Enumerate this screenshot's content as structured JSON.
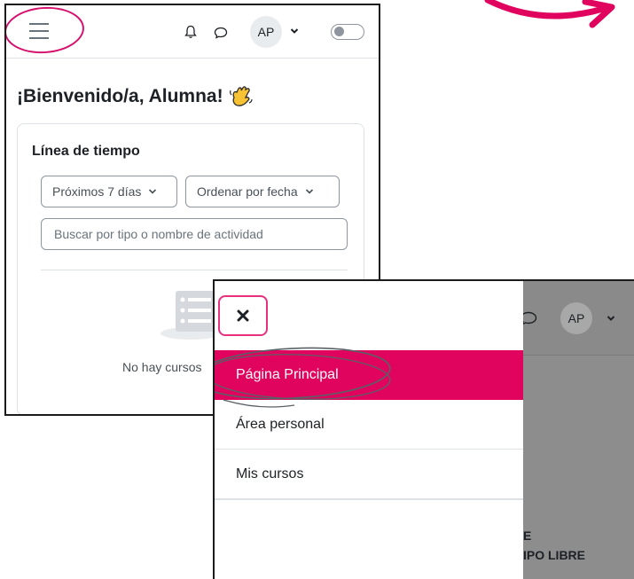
{
  "colors": {
    "accent": "#e0045e",
    "highlight_ring": "#d6106d",
    "overlay": "#8d8d8d"
  },
  "dashboard": {
    "nav": {
      "menu_icon": "hamburger-menu-icon",
      "notification_icon": "bell-icon",
      "messages_icon": "chat-bubble-icon",
      "avatar_initials": "AP",
      "user_menu_icon": "chevron-down-icon",
      "edit_mode_icon": "toggle-switch-icon"
    },
    "welcome": "¡Bienvenido/a, Alumna!",
    "welcome_emoji": "waving-hand-icon",
    "timeline": {
      "title": "Línea de tiempo",
      "filter_selected": "Próximos 7 días",
      "sort_selected": "Ordenar por fecha",
      "search_placeholder": "Buscar por tipo o nombre de actividad",
      "empty_icon": "empty-list-icon",
      "empty_text": "No hay cursos"
    }
  },
  "drawer": {
    "close_icon": "close-icon",
    "items": [
      {
        "label": "Página Principal",
        "active": true
      },
      {
        "label": "Área personal",
        "active": false
      },
      {
        "label": "Mis cursos",
        "active": false
      }
    ],
    "background_nav": {
      "messages_icon": "chat-bubble-icon",
      "avatar_initials": "AP",
      "user_menu_icon": "chevron-down-icon"
    },
    "background_text_line1": "E",
    "background_text_line2": "IPO LIBRE"
  }
}
